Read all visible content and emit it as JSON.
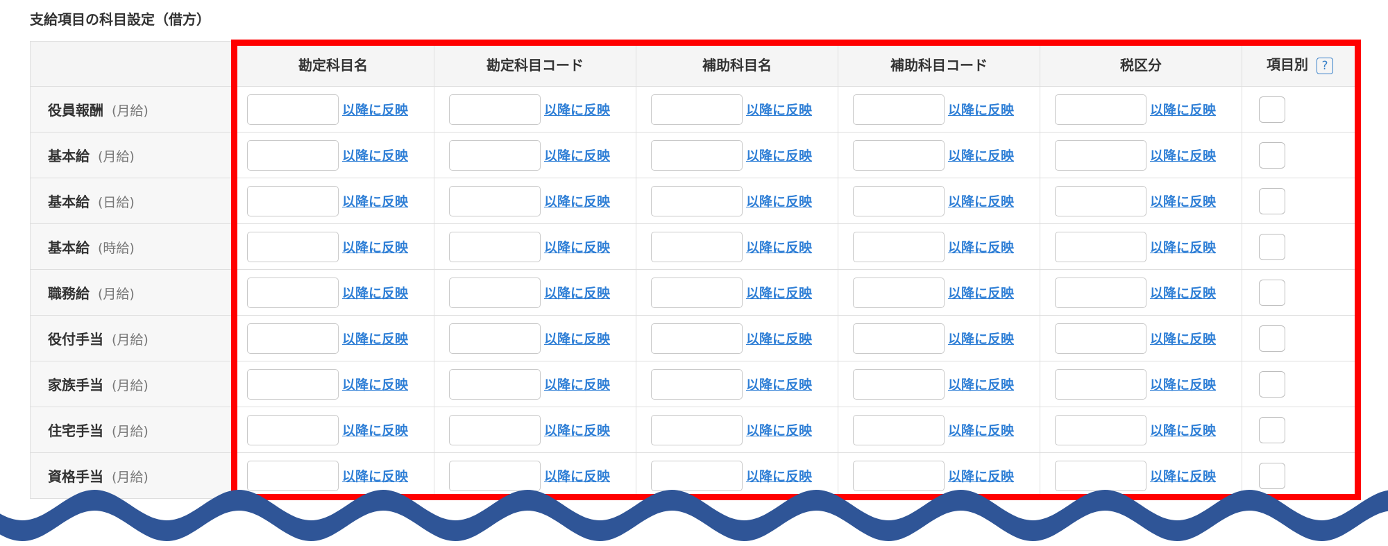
{
  "section_title": "支給項目の科目設定（借方）",
  "columns": [
    "",
    "勘定科目名",
    "勘定科目コード",
    "補助科目名",
    "補助科目コード",
    "税区分",
    "項目別"
  ],
  "help_glyph": "?",
  "apply_link": "以降に反映",
  "rows": [
    {
      "name": "役員報酬",
      "type": "(月給)"
    },
    {
      "name": "基本給",
      "type": "(月給)"
    },
    {
      "name": "基本給",
      "type": "(日給)"
    },
    {
      "name": "基本給",
      "type": "(時給)"
    },
    {
      "name": "職務給",
      "type": "(月給)"
    },
    {
      "name": "役付手当",
      "type": "(月給)"
    },
    {
      "name": "家族手当",
      "type": "(月給)"
    },
    {
      "name": "住宅手当",
      "type": "(月給)"
    },
    {
      "name": "資格手当",
      "type": "(月給)"
    }
  ],
  "colors": {
    "highlight": "#ff0000",
    "wave": "#2f5597",
    "link": "#2f7fd6"
  }
}
